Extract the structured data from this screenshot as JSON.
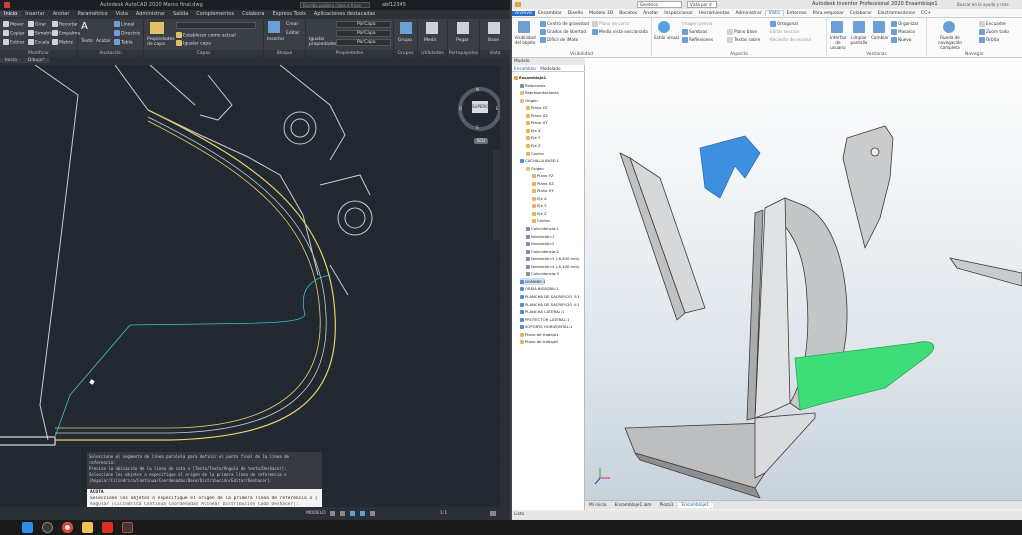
{
  "autocad": {
    "title": "Autodesk AutoCAD 2020   Marco final.dwg",
    "search_placeholder": "Escriba palabra clave o frase",
    "user": "abf12345",
    "menu_tabs": [
      "Inicio",
      "Insertar",
      "Anotar",
      "Paramétrico",
      "Vista",
      "Administrar",
      "Salida",
      "Complementos",
      "Colabora",
      "Express Tools",
      "Aplicaciones destacadas"
    ],
    "active_tab": "Inicio",
    "panels": {
      "modificar": {
        "title": "Modificar",
        "items": [
          "Mover",
          "Girar",
          "Recortar",
          "Copiar",
          "Simetría",
          "Empalme",
          "Estirar",
          "Escala",
          "Matriz"
        ]
      },
      "anotacion": {
        "title": "Anotación",
        "items": [
          "Texto",
          "Acotar",
          "Lineal",
          "Directriz",
          "Tabla"
        ]
      },
      "capas": {
        "title": "Capas",
        "items": [
          "Propiedades de capa",
          "Establecer como actual",
          "Igualar capa"
        ]
      },
      "bloque": {
        "title": "Bloque",
        "items": [
          "Insertar",
          "Crear",
          "Editar"
        ]
      },
      "propiedades": {
        "title": "Propiedades",
        "items": [
          "Igualar propiedades",
          "PorCapa",
          "PorCapa",
          "PorCapa"
        ]
      },
      "grupos": {
        "title": "Grupos",
        "items": [
          "Grupo"
        ]
      },
      "utilidades": {
        "title": "Utilidades",
        "items": [
          "Medir"
        ]
      },
      "portapapeles": {
        "title": "Portapapeles",
        "items": [
          "Pegar"
        ]
      },
      "vista": {
        "title": "Vista",
        "items": [
          "Base"
        ]
      }
    },
    "doc_tabs": [
      "Inicio",
      "Dibujo*"
    ],
    "viewcube": {
      "top": "SUPERIOR",
      "n": "N",
      "s": "S",
      "e": "E",
      "o": "O"
    },
    "wcs_label": "SCU",
    "command_history": [
      "Seleccione el segmento de línea paralela para definir el punto final de la línea de",
      "referencia:",
      "Precise la ubicación de la línea de cota o [Texto/Texto/Ángulo de texto/Deshacer]:",
      "Seleccione los objetos o especifique el origen de la primera línea de referencia o",
      "[Angular/Cilíndrica/Continua/Coordenadas/Base/Distribución/Editar/Deshacer]:"
    ],
    "command_prompt": "ACOTA",
    "command_current": "Seleccione los objetos o especifique el origen de la primera línea de referencia o [",
    "command_options": "Angular [Cilíndrica Continua Coordenadas Alinear Distribución Cada Deshacer]:",
    "status": {
      "model": "MODELO",
      "scale": "1:1"
    }
  },
  "inventor": {
    "title": "Autodesk Inventor Professional 2020   Ensamblaje1",
    "view_select": "Genérico",
    "view_mode": "Vista por d",
    "search_placeholder": "Buscar en la ayuda y más",
    "user": "Iniciar sesión",
    "menu_tabs": [
      "Archivo",
      "Ensamblar",
      "Diseño",
      "Modelo 3D",
      "Bocetos",
      "Anotar",
      "Inspeccionar",
      "Herramientas",
      "Administrar",
      "Vista",
      "Entornos",
      "Para empezar",
      "Colaborar",
      "Electromecánico",
      "CC+"
    ],
    "active_tab": "Vista",
    "panels": {
      "visibilidad": {
        "title": "Visibilidad",
        "items": [
          "Visibilidad del objeto",
          "Centro de gravedad",
          "Grados de libertad",
          "Difícil de iMate",
          "Plano de corte",
          "Media vista seccionada"
        ]
      },
      "aspecto": {
        "title": "Aspecto",
        "items": [
          "Estilo visual",
          "Sombras",
          "Reflexiones",
          "Imagen previa",
          "Plano base",
          "Textos sobre",
          "Ortogonal",
          "Editar sección",
          "Reciente de escena"
        ]
      },
      "ventanas": {
        "title": "Ventanas",
        "items": [
          "Interfaz de usuario",
          "Limpiar pantalla",
          "Cambiar",
          "Mosaico",
          "Organizar",
          "Nuevo"
        ]
      },
      "navegar": {
        "title": "Navegar",
        "items": [
          "Rueda de navegación completa",
          "Encuadre",
          "Zoom todo",
          "Órbita"
        ]
      }
    },
    "browser": {
      "title": "Modelo",
      "tabs": [
        "Ensamblar",
        "Modelado"
      ],
      "items": [
        {
          "label": "Ensamblaje1",
          "level": 0,
          "type": "asm"
        },
        {
          "label": "Relaciones",
          "level": 1,
          "type": "rel"
        },
        {
          "label": "Representaciones",
          "level": 1,
          "type": "folder"
        },
        {
          "label": "Origen",
          "level": 1,
          "type": "folder"
        },
        {
          "label": "Plano YZ",
          "level": 2,
          "type": "plane"
        },
        {
          "label": "Plano XZ",
          "level": 2,
          "type": "plane"
        },
        {
          "label": "Plano XY",
          "level": 2,
          "type": "plane"
        },
        {
          "label": "Eje X",
          "level": 2,
          "type": "axis"
        },
        {
          "label": "Eje Y",
          "level": 2,
          "type": "axis"
        },
        {
          "label": "Eje Z",
          "level": 2,
          "type": "axis"
        },
        {
          "label": "Centro",
          "level": 2,
          "type": "point"
        },
        {
          "label": "CUCHILLA BASE:1",
          "level": 1,
          "type": "part"
        },
        {
          "label": "Origen",
          "level": 2,
          "type": "folder"
        },
        {
          "label": "Plano YZ",
          "level": 3,
          "type": "plane"
        },
        {
          "label": "Plano XZ",
          "level": 3,
          "type": "plane"
        },
        {
          "label": "Plano XY",
          "level": 3,
          "type": "plane"
        },
        {
          "label": "Eje X",
          "level": 3,
          "type": "axis"
        },
        {
          "label": "Eje Y",
          "level": 3,
          "type": "axis"
        },
        {
          "label": "Eje Z",
          "level": 3,
          "type": "axis"
        },
        {
          "label": "Centro",
          "level": 3,
          "type": "point"
        },
        {
          "label": "Coincidencia:1",
          "level": 2,
          "type": "rel"
        },
        {
          "label": "Nivelación:1",
          "level": 2,
          "type": "rel"
        },
        {
          "label": "Nivelación:2",
          "level": 2,
          "type": "rel"
        },
        {
          "label": "Coincidencia:2",
          "level": 2,
          "type": "rel"
        },
        {
          "label": "Nivelación:3 (-6,500 mm)",
          "level": 2,
          "type": "rel"
        },
        {
          "label": "Nivelación:4 (-6,100 mm)",
          "level": 2,
          "type": "rel"
        },
        {
          "label": "Coincidencia:3",
          "level": 2,
          "type": "rel"
        },
        {
          "label": "NOMBRE:1",
          "level": 1,
          "type": "part",
          "selected": true
        },
        {
          "label": "OREJA BISAGRA:1",
          "level": 1,
          "type": "part"
        },
        {
          "label": "PLANCHA DE SACRIFICIO 3:1",
          "level": 1,
          "type": "part"
        },
        {
          "label": "PLANCHA DE SACRIFICIO 4:1",
          "level": 1,
          "type": "part"
        },
        {
          "label": "PLANCHA LATERAL:1",
          "level": 1,
          "type": "part"
        },
        {
          "label": "PROTECTOR LATERAL:1",
          "level": 1,
          "type": "part"
        },
        {
          "label": "SOPORTE HORIZONTAL:1",
          "level": 1,
          "type": "part"
        },
        {
          "label": "Plano de trabajo1",
          "level": 1,
          "type": "plane"
        },
        {
          "label": "Plano de trabajo2",
          "level": 1,
          "type": "plane"
        }
      ]
    },
    "doc_tabs": [
      "Mi inicio",
      "Ensamblaje1.iam",
      "Pieza1",
      "Ensamblaje1"
    ],
    "active_doc_tab": "Ensamblaje1",
    "status": "Listo",
    "accent": "#1f5fa8",
    "part_colors": {
      "steel": "#c9cbcd",
      "blue": "#3d8fe0",
      "green": "#3fdc7a"
    }
  },
  "taskbar": {
    "icons": [
      "windows-icon",
      "search-icon",
      "task-view-icon",
      "chrome-icon",
      "file-explorer-icon",
      "autocad-icon",
      "inventor-icon"
    ]
  }
}
